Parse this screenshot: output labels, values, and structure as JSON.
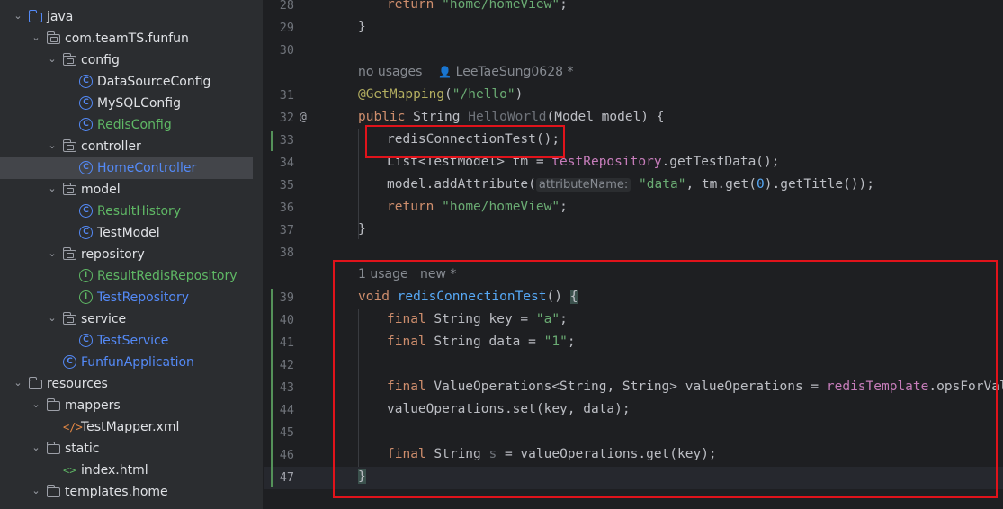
{
  "project_tree": [
    {
      "label": "java",
      "icon": "source-folder-icon",
      "chevron": "expanded",
      "style": "default"
    },
    {
      "label": "com.teamTS.funfun",
      "icon": "package-icon",
      "chevron": "expanded",
      "style": "default"
    },
    {
      "label": "config",
      "icon": "package-icon",
      "chevron": "expanded",
      "style": "default"
    },
    {
      "label": "DataSourceConfig",
      "icon": "class-icon",
      "chevron": "",
      "style": "default"
    },
    {
      "label": "MySQLConfig",
      "icon": "class-icon",
      "chevron": "",
      "style": "default"
    },
    {
      "label": "RedisConfig",
      "icon": "class-icon",
      "chevron": "",
      "style": "green"
    },
    {
      "label": "controller",
      "icon": "package-icon",
      "chevron": "expanded",
      "style": "default"
    },
    {
      "label": "HomeController",
      "icon": "class-icon",
      "chevron": "",
      "style": "blue",
      "selected": true
    },
    {
      "label": "model",
      "icon": "package-icon",
      "chevron": "expanded",
      "style": "default"
    },
    {
      "label": "ResultHistory",
      "icon": "class-icon",
      "chevron": "",
      "style": "green"
    },
    {
      "label": "TestModel",
      "icon": "class-icon",
      "chevron": "",
      "style": "default"
    },
    {
      "label": "repository",
      "icon": "package-icon",
      "chevron": "expanded",
      "style": "default"
    },
    {
      "label": "ResultRedisRepository",
      "icon": "interface-icon",
      "chevron": "",
      "style": "green"
    },
    {
      "label": "TestRepository",
      "icon": "interface-icon",
      "chevron": "",
      "style": "blue"
    },
    {
      "label": "service",
      "icon": "package-icon",
      "chevron": "expanded",
      "style": "default"
    },
    {
      "label": "TestService",
      "icon": "class-icon",
      "chevron": "",
      "style": "blue"
    },
    {
      "label": "FunfunApplication",
      "icon": "class-icon",
      "chevron": "",
      "style": "blue"
    },
    {
      "label": "resources",
      "icon": "resources-folder-icon",
      "chevron": "expanded",
      "style": "default"
    },
    {
      "label": "mappers",
      "icon": "folder-icon",
      "chevron": "expanded",
      "style": "default"
    },
    {
      "label": "TestMapper.xml",
      "icon": "xml-file-icon",
      "chevron": "",
      "style": "default"
    },
    {
      "label": "static",
      "icon": "folder-icon",
      "chevron": "expanded",
      "style": "default"
    },
    {
      "label": "index.html",
      "icon": "html-file-icon",
      "chevron": "",
      "style": "default"
    },
    {
      "label": "templates.home",
      "icon": "folder-icon",
      "chevron": "expanded",
      "style": "default"
    }
  ],
  "editor": {
    "line_numbers": [
      "28",
      "29",
      "30",
      "31",
      "32",
      "33",
      "34",
      "35",
      "36",
      "37",
      "38",
      "39",
      "40",
      "41",
      "42",
      "43",
      "44",
      "45",
      "46",
      "47"
    ],
    "current_line": "47",
    "hint_usages_1": "no usages",
    "hint_author": "LeeTaeSung0628 *",
    "hint_usages_2": "1 usage",
    "hint_new": "new *",
    "code": {
      "l28_kw": "return",
      "l28_str": "\"home/homeView\"",
      "l28_end": ";",
      "l29": "}",
      "l31_ann": "@GetMapping",
      "l31_p1": "(",
      "l31_str": "\"/hello\"",
      "l31_p2": ")",
      "l32_kw": "public",
      "l32_type": " String ",
      "l32_name": "HelloWorld",
      "l32_params": "(Model model) {",
      "l33": "redisConnectionTest();",
      "l34_a": "List<TestModel> tm = ",
      "l34_fld": "testRepository",
      "l34_b": ".getTestData();",
      "l35_a": "model.addAttribute(",
      "l35_inlay": "attributeName:",
      "l35_str": "\"data\"",
      "l35_b": ", tm.get(",
      "l35_num": "0",
      "l35_c": ").getTitle());",
      "l36_kw": "return",
      "l36_str": "\"home/homeView\"",
      "l36_end": ";",
      "l37": "}",
      "l39_kw": "void",
      "l39_name": "redisConnectionTest",
      "l39_end": "() ",
      "l39_brace": "{",
      "l40_kw": "final",
      "l40_a": " String key = ",
      "l40_str": "\"a\"",
      "l40_end": ";",
      "l41_kw": "final",
      "l41_a": " String data = ",
      "l41_str": "\"1\"",
      "l41_end": ";",
      "l43_kw": "final",
      "l43_a": " ValueOperations<String, String> valueOperations = ",
      "l43_fld": "redisTemplate",
      "l43_b": ".opsForValue();",
      "l44": "valueOperations.set(key, data);",
      "l46_kw": "final",
      "l46_a": " String ",
      "l46_var": "s",
      "l46_b": " = valueOperations.get(key);",
      "l47_brace": "}"
    }
  }
}
